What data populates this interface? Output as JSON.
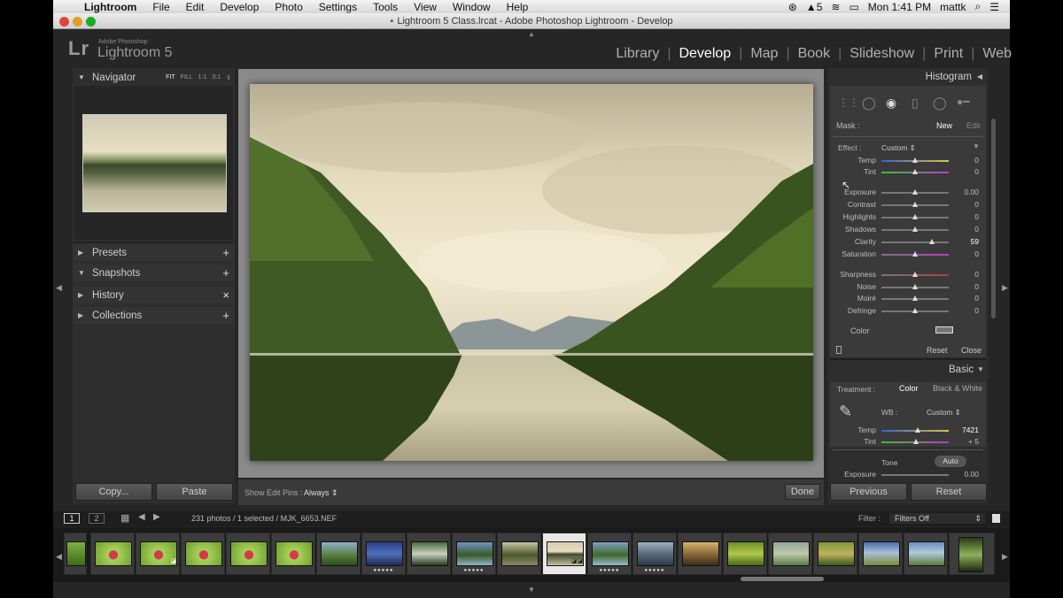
{
  "menubar": {
    "app": "Lightroom",
    "items": [
      "File",
      "Edit",
      "Develop",
      "Photo",
      "Settings",
      "Tools",
      "View",
      "Window",
      "Help"
    ],
    "status_num": "5",
    "clock": "Mon 1:41 PM",
    "user": "mattk"
  },
  "window": {
    "title": "Lightroom 5 Class.lrcat - Adobe Photoshop Lightroom - Develop"
  },
  "identity": {
    "logo": "Lr",
    "adobe": "Adobe Photoshop",
    "product": "Lightroom 5"
  },
  "modules": [
    "Library",
    "Develop",
    "Map",
    "Book",
    "Slideshow",
    "Print",
    "Web"
  ],
  "active_module": "Develop",
  "left_panel": {
    "navigator": {
      "title": "Navigator",
      "options": [
        "FIT",
        "FILL",
        "1:1",
        "3:1"
      ]
    },
    "presets": "Presets",
    "snapshots": "Snapshots",
    "history": "History",
    "collections": "Collections",
    "copy_label": "Copy...",
    "paste_label": "Paste"
  },
  "toolbar": {
    "show_edit_pins_label": "Show Edit Pins :",
    "show_edit_pins_value": "Always",
    "done_label": "Done"
  },
  "right_panel": {
    "histogram": "Histogram",
    "mask_label": "Mask :",
    "mask_new": "New",
    "mask_edit": "Edit",
    "effect_label": "Effect :",
    "effect_value": "Custom",
    "sliders": [
      {
        "label": "Temp",
        "value": "0",
        "pos": 0.5
      },
      {
        "label": "Tint",
        "value": "0",
        "pos": 0.5
      },
      {
        "label": "Exposure",
        "value": "0.00",
        "pos": 0.5
      },
      {
        "label": "Contrast",
        "value": "0",
        "pos": 0.5
      },
      {
        "label": "Highlights",
        "value": "0",
        "pos": 0.5
      },
      {
        "label": "Shadows",
        "value": "0",
        "pos": 0.5
      },
      {
        "label": "Clarity",
        "value": "59",
        "pos": 0.75
      },
      {
        "label": "Saturation",
        "value": "0",
        "pos": 0.5
      },
      {
        "label": "Sharpness",
        "value": "0",
        "pos": 0.5
      },
      {
        "label": "Noise",
        "value": "0",
        "pos": 0.5
      },
      {
        "label": "Moiré",
        "value": "0",
        "pos": 0.5
      },
      {
        "label": "Defringe",
        "value": "0",
        "pos": 0.5
      }
    ],
    "color_label": "Color",
    "reset_label": "Reset",
    "close_label": "Close",
    "basic": {
      "title": "Basic",
      "treatment_label": "Treatment :",
      "treatment_color": "Color",
      "treatment_bw": "Black & White",
      "wb_label": "WB :",
      "wb_value": "Custom",
      "temp_label": "Temp",
      "temp_value": "7421",
      "tint_label": "Tint",
      "tint_value": "+ 5",
      "tone_label": "Tone",
      "auto_label": "Auto",
      "exposure_label": "Exposure",
      "exposure_value": "0.00"
    },
    "previous_label": "Previous",
    "reset_button_label": "Reset"
  },
  "filmstrip": {
    "page1": "1",
    "page2": "2",
    "info": "231 photos / 1 selected / MJK_6653.NEF",
    "filter_label": "Filter :",
    "filter_value": "Filters Off"
  },
  "colors": {
    "panel_bg": "#2e2e2e",
    "app_bg": "#262626",
    "center_bg": "#8a8a8a",
    "accent_active": "#ffffff"
  }
}
